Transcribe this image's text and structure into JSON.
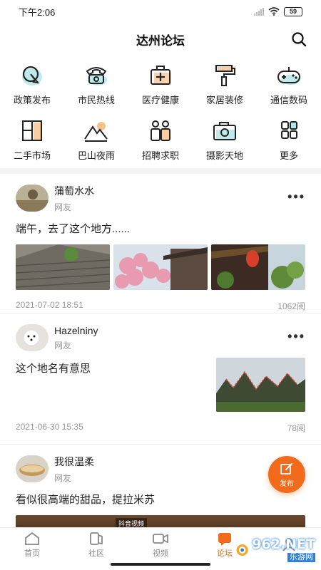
{
  "status": {
    "time": "下午2:06",
    "battery": "59"
  },
  "header": {
    "title": "达州论坛",
    "search_icon": "search-icon"
  },
  "categories": [
    {
      "label": "政策发布",
      "icon": "policy-icon"
    },
    {
      "label": "市民热线",
      "icon": "telephone-icon"
    },
    {
      "label": "医疗健康",
      "icon": "medical-kit-icon"
    },
    {
      "label": "家居装修",
      "icon": "paint-roller-icon"
    },
    {
      "label": "通信数码",
      "icon": "gamepad-icon"
    },
    {
      "label": "二手市场",
      "icon": "door-icon"
    },
    {
      "label": "巴山夜雨",
      "icon": "mountain-icon"
    },
    {
      "label": "招聘求职",
      "icon": "people-icon"
    },
    {
      "label": "摄影天地",
      "icon": "camera-icon"
    },
    {
      "label": "更多",
      "icon": "grid-icon"
    }
  ],
  "posts": [
    {
      "author": "蒲萄水水",
      "role": "网友",
      "text": "端午，去了这个地方......",
      "date": "2021-07-02 18:51",
      "views": "1062阅"
    },
    {
      "author": "Hazelniny",
      "role": "网友",
      "text": "这个地名有意思",
      "date": "2021-06-30 15:35",
      "views": "78阅"
    },
    {
      "author": "我很温柔",
      "role": "网友",
      "text": "看似很高端的甜品，提拉米苏"
    }
  ],
  "video_overlay": "抖音视频",
  "fab": {
    "label": "发布"
  },
  "tabs": [
    {
      "label": "首页",
      "icon": "home-icon"
    },
    {
      "label": "社区",
      "icon": "community-icon"
    },
    {
      "label": "视频",
      "icon": "video-icon"
    },
    {
      "label": "论坛",
      "icon": "forum-icon"
    },
    {
      "label": "",
      "icon": "profile-icon"
    }
  ],
  "watermark": {
    "big": "962.NET",
    "small": "乐游网"
  },
  "colors": {
    "accent": "#f26b1d",
    "text": "#222222",
    "muted": "#999999"
  }
}
